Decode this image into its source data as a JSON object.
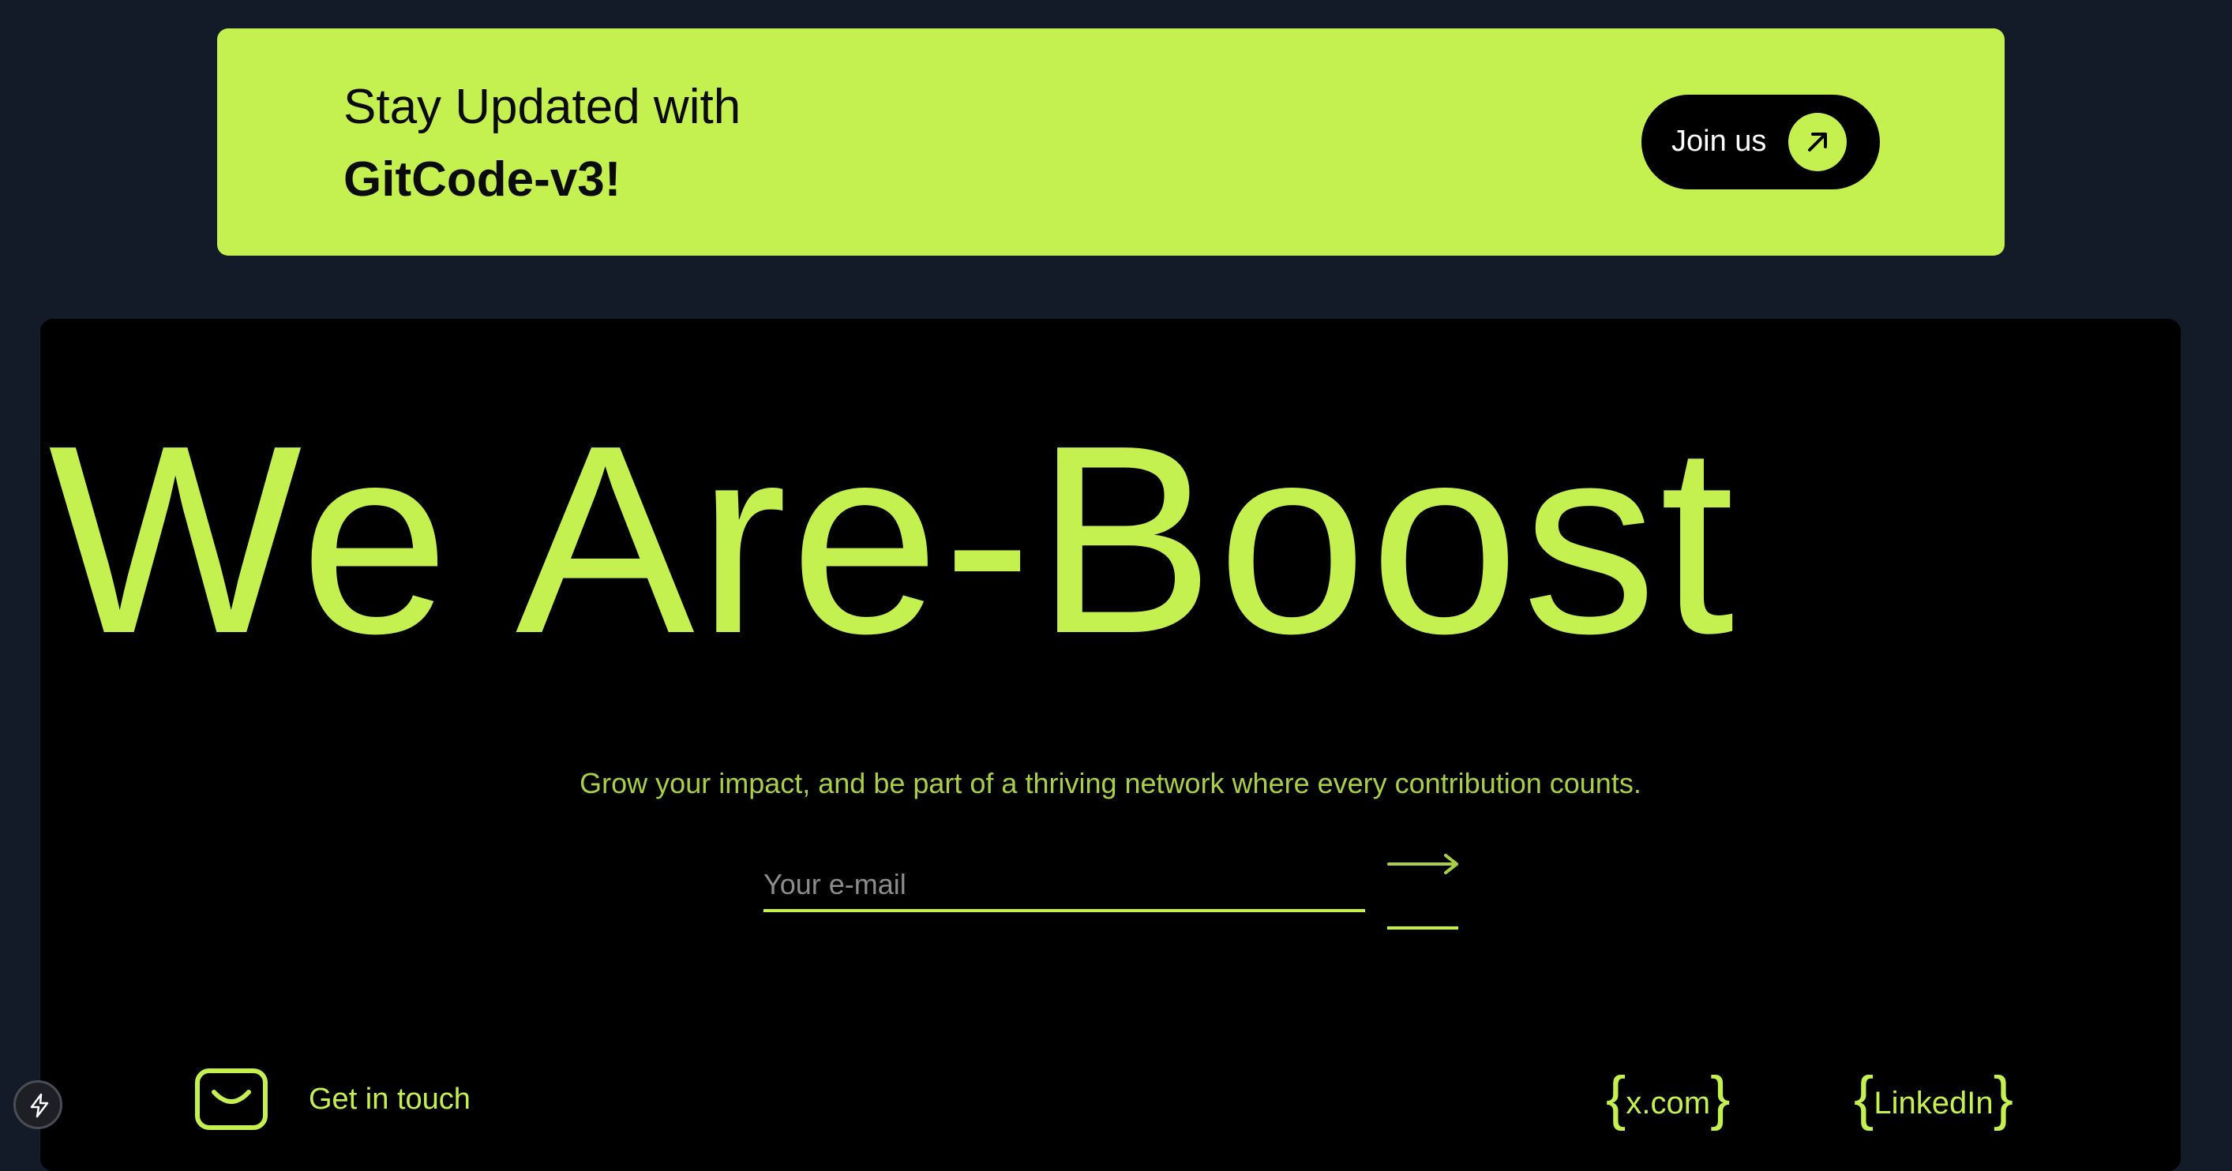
{
  "banner": {
    "line1": "Stay Updated with",
    "line2": "GitCode-v3!",
    "button_label": "Join us",
    "button_icon": "arrow-up-right-icon"
  },
  "hero": {
    "title": "We Are-Boost",
    "subtitle": "Grow your impact, and be part of a thriving network where every contribution counts."
  },
  "signup": {
    "email_placeholder": "Your e-mail",
    "email_value": "",
    "submit_icon": "long-arrow-right-icon"
  },
  "footer": {
    "contact_icon": "mail-icon",
    "contact_label": "Get in touch",
    "social": [
      {
        "label": "x.com"
      },
      {
        "label": "LinkedIn"
      }
    ]
  },
  "dev_tool_icon": "lightning-bolt-icon",
  "colors": {
    "accent": "#c4f050",
    "page_bg": "#131a28",
    "panel_bg": "#000000"
  }
}
